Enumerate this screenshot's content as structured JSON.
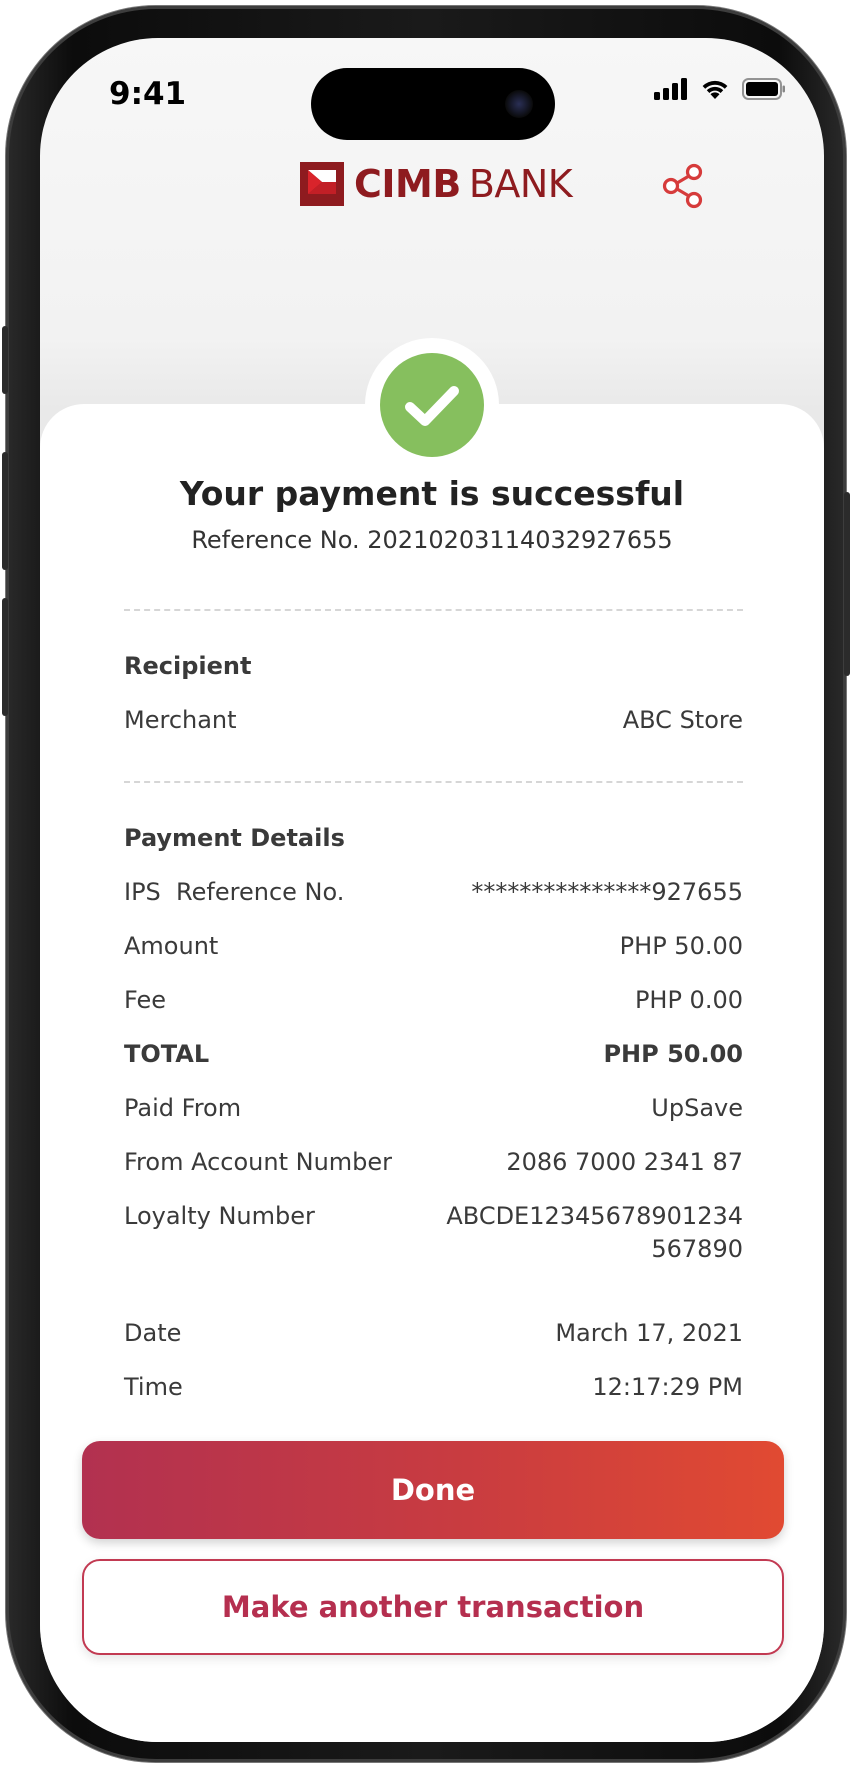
{
  "status_bar": {
    "time": "9:41"
  },
  "header": {
    "brand_primary": "CIMB",
    "brand_secondary": "BANK",
    "brand_color": "#8e1b1f",
    "share_icon": "share-icon",
    "share_color": "#d63b3b"
  },
  "result": {
    "title": "Your payment is successful",
    "reference": "Reference No. 20210203114032927655",
    "success_color": "#86bf5e"
  },
  "recipient": {
    "heading": "Recipient",
    "rows": [
      {
        "label": "Merchant",
        "value": "ABC Store"
      }
    ]
  },
  "payment_details": {
    "heading": "Payment Details",
    "ips_reference": {
      "label": "IPS  Reference No.",
      "value": "***************927655"
    },
    "amount": {
      "label": "Amount",
      "value": "PHP 50.00"
    },
    "fee": {
      "label": "Fee",
      "value": "PHP 0.00"
    },
    "total": {
      "label": "TOTAL",
      "value": "PHP 50.00"
    },
    "paid_from": {
      "label": "Paid From",
      "value": "UpSave"
    },
    "from_account": {
      "label": "From Account Number",
      "value": "2086 7000 2341 87"
    },
    "loyalty": {
      "label": "Loyalty Number",
      "value": "ABCDE12345678901234567890"
    },
    "date": {
      "label": "Date",
      "value": "March 17, 2021"
    },
    "time": {
      "label": "Time",
      "value": "12:17:29 PM"
    }
  },
  "actions": {
    "done_label": "Done",
    "another_label": "Make another transaction",
    "primary_gradient": [
      "#b23150",
      "#e14a32"
    ]
  }
}
